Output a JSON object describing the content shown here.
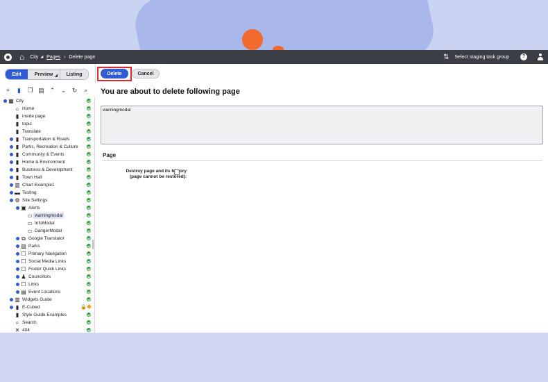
{
  "topbar": {
    "breadcrumbs": [
      {
        "label": "City",
        "dropdown": true
      },
      {
        "label": "Pages",
        "link": true
      },
      {
        "label": "Delete page"
      }
    ],
    "staging_label": "Select staging task group",
    "help_label": "?"
  },
  "view_modes": {
    "edit": "Edit",
    "preview": "Preview",
    "listing": "Listing"
  },
  "actions": {
    "delete": "Delete",
    "cancel": "Cancel"
  },
  "content": {
    "title": "You are about to delete following page",
    "page_name": "warningmodal",
    "section": "Page",
    "destroy_label_1": "Destroy page and its history",
    "destroy_label_2": "(page cannot be restored):",
    "destroy_checked": false
  },
  "tree": {
    "items": [
      {
        "label": "City",
        "icon": "site-icon",
        "status": "published"
      },
      {
        "label": "Home",
        "icon": "home-icon",
        "status": "published"
      },
      {
        "label": "inside page",
        "icon": "page-icon",
        "status": "published"
      },
      {
        "label": "topic",
        "icon": "page-icon",
        "status": "published"
      },
      {
        "label": "Translate",
        "icon": "page-icon",
        "status": "published"
      },
      {
        "label": "Transportation & Roads",
        "icon": "page-icon",
        "status": "published"
      },
      {
        "label": "Parks, Recreation & Culture",
        "icon": "page-icon",
        "status": "published"
      },
      {
        "label": "Community & Events",
        "icon": "page-icon",
        "status": "published"
      },
      {
        "label": "Home & Environment",
        "icon": "page-icon",
        "status": "published"
      },
      {
        "label": "Business & Development",
        "icon": "page-icon",
        "status": "published"
      },
      {
        "label": "Town Hall",
        "icon": "page-icon",
        "status": "published"
      },
      {
        "label": "Chart Example1",
        "icon": "chart-icon",
        "status": "published"
      },
      {
        "label": "Testing",
        "icon": "folder-icon",
        "status": "published"
      },
      {
        "label": "Site Settings",
        "icon": "gear-icon",
        "status": "published"
      },
      {
        "label": "Alerts",
        "icon": "alerts-icon",
        "status": "published"
      },
      {
        "label": "warningmodal",
        "icon": "modal-icon",
        "status": "published"
      },
      {
        "label": "InfoModal",
        "icon": "modal-icon",
        "status": "published"
      },
      {
        "label": "DangerModal",
        "icon": "modal-icon",
        "status": "published"
      },
      {
        "label": "Google Translator",
        "icon": "translate-icon",
        "status": "published"
      },
      {
        "label": "Parks",
        "icon": "image-icon",
        "status": "published"
      },
      {
        "label": "Primary Navigation",
        "icon": "box-icon",
        "status": "published"
      },
      {
        "label": "Social Media Links",
        "icon": "box-icon",
        "status": "published"
      },
      {
        "label": "Footer Quick Links",
        "icon": "box-icon",
        "status": "published"
      },
      {
        "label": "Councillors",
        "icon": "people-icon",
        "status": "published"
      },
      {
        "label": "Links",
        "icon": "box-icon",
        "status": "published"
      },
      {
        "label": "Event Locations",
        "icon": "table-icon",
        "status": "published"
      },
      {
        "label": "Widgets Guide",
        "icon": "chart-icon",
        "status": "published"
      },
      {
        "label": "E-Cubed",
        "icon": "page-icon",
        "status": "locked"
      },
      {
        "label": "Style Guide Examples",
        "icon": "page-icon",
        "status": "published"
      },
      {
        "label": "Search",
        "icon": "search-icon",
        "status": "published"
      },
      {
        "label": "404",
        "icon": "close-icon",
        "status": "published"
      }
    ]
  },
  "colors": {
    "accent": "#2f5bd6",
    "topbar": "#3b3d45",
    "highlight": "#e0282e",
    "published": "#2fa23a",
    "pending": "#f0a22d"
  }
}
